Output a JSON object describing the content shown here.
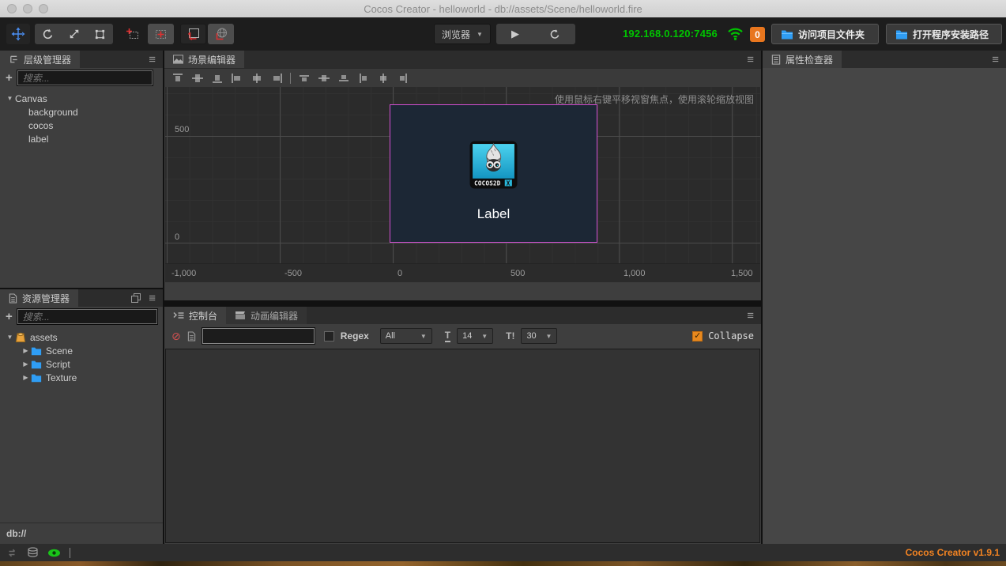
{
  "window": {
    "title": "Cocos Creator - helloworld - db://assets/Scene/helloworld.fire"
  },
  "toolbar": {
    "preview_target": "浏览器",
    "ip_address": "192.168.0.120:7456",
    "error_badge": "0",
    "open_project_label": "访问项目文件夹",
    "open_install_label": "打开程序安装路径"
  },
  "panels": {
    "hierarchy": {
      "title": "层级管理器",
      "search_placeholder": "搜索...",
      "root_node": "Canvas",
      "children": [
        "background",
        "cocos",
        "label"
      ]
    },
    "scene": {
      "title": "场景编辑器",
      "hint": "使用鼠标右键平移视窗焦点，使用滚轮缩放视图",
      "ruler_y": [
        "500",
        "0"
      ],
      "ruler_x": [
        "-1,000",
        "-500",
        "0",
        "500",
        "1,000",
        "1,500"
      ],
      "canvas_label": "Label",
      "logo_text": "COCOS2D",
      "logo_x": "X"
    },
    "assets": {
      "title": "资源管理器",
      "search_placeholder": "搜索...",
      "root_node": "assets",
      "folders": [
        "Scene",
        "Script",
        "Texture"
      ],
      "path": "db://"
    },
    "console": {
      "title": "控制台",
      "animation_title": "动画编辑器",
      "search_value": "",
      "regex_label": "Regex",
      "filter_selected": "All",
      "font_size": "14",
      "line_count": "30",
      "collapse_label": "Collapse",
      "collapse_check": "✓"
    },
    "inspector": {
      "title": "属性检查器"
    }
  },
  "statusbar": {
    "version": "Cocos Creator v1.9.1"
  },
  "glyphs": {
    "menu": "≡",
    "dropdown_arrow": "▼",
    "play": "▶",
    "plus": "+",
    "expand": "▼",
    "collapse_arrow": "▶",
    "clear": "⊘",
    "t_small": "T",
    "t_excl": "T!"
  },
  "colors": {
    "accent_green": "#00c400",
    "badge_orange": "#e8761e",
    "version_orange": "#f28322",
    "canvas_magenta": "#d24fd2",
    "move_blue": "#4a8df0",
    "folder_blue": "#2f9df4"
  }
}
